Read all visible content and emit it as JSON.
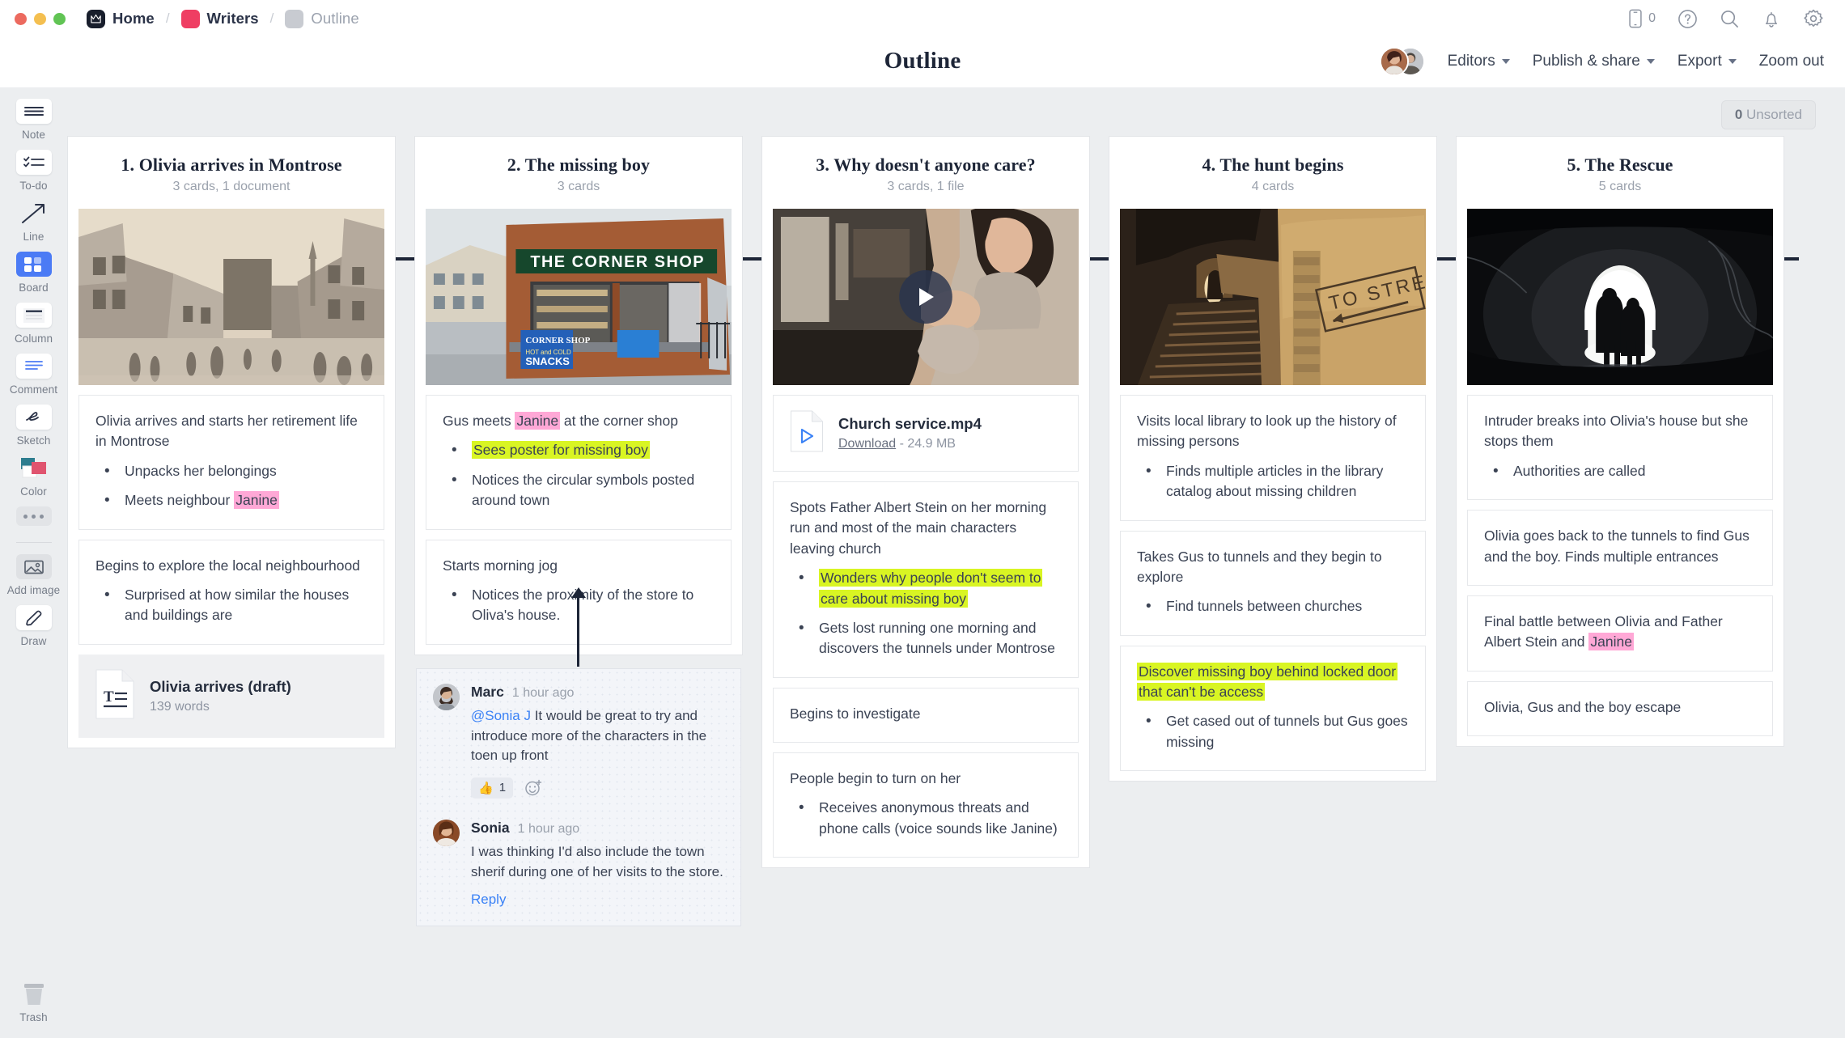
{
  "window": {
    "traffic_lights": [
      "close",
      "minimize",
      "maximize"
    ]
  },
  "breadcrumb": {
    "items": [
      {
        "label": "Home",
        "icon": "milanote-logo-icon",
        "color": "#181e2c"
      },
      {
        "label": "Writers",
        "icon": "board-swatch-icon",
        "color": "#ef3e63"
      },
      {
        "label": "Outline",
        "icon": "board-swatch-icon",
        "color": "#c8cbd1"
      }
    ],
    "separator": "/"
  },
  "topbar_icons": [
    {
      "name": "mobile-icon",
      "badge": "0"
    },
    {
      "name": "help-icon"
    },
    {
      "name": "search-icon"
    },
    {
      "name": "notifications-bell-icon"
    },
    {
      "name": "settings-gear-icon"
    }
  ],
  "header": {
    "title": "Outline",
    "actions": [
      {
        "label": "Editors",
        "has_caret": true
      },
      {
        "label": "Publish & share",
        "has_caret": true
      },
      {
        "label": "Export",
        "has_caret": true
      },
      {
        "label": "Zoom out",
        "has_caret": false
      }
    ]
  },
  "sidebar": {
    "tools": [
      {
        "label": "Note",
        "icon": "note-icon",
        "active": false
      },
      {
        "label": "To-do",
        "icon": "todo-icon",
        "active": false
      },
      {
        "label": "Line",
        "icon": "line-arrow-icon",
        "active": false
      },
      {
        "label": "Board",
        "icon": "board-icon",
        "active": true
      },
      {
        "label": "Column",
        "icon": "column-icon",
        "active": false
      },
      {
        "label": "Comment",
        "icon": "comment-icon",
        "active": false
      },
      {
        "label": "Sketch",
        "icon": "sketch-icon",
        "active": false
      },
      {
        "label": "Color",
        "icon": "color-swatches-icon",
        "active": false
      },
      {
        "label": "",
        "icon": "more-dots-icon",
        "active": false
      },
      {
        "label": "Add image",
        "icon": "add-image-icon",
        "active": false
      },
      {
        "label": "Draw",
        "icon": "draw-pencil-icon",
        "active": false
      }
    ],
    "trash": {
      "label": "Trash",
      "icon": "trash-icon"
    }
  },
  "canvas": {
    "unsorted_badge": {
      "count": "0",
      "label": "Unsorted"
    }
  },
  "columns": [
    {
      "title": "1. Olivia arrives in Montrose",
      "subtitle": "3 cards, 1 document",
      "hero": {
        "name": "vintage-street-photo",
        "type": "image"
      },
      "cards": [
        {
          "type": "note",
          "text": "Olivia arrives and starts her retirement life in Montrose",
          "bullets": [
            {
              "text": "Unpacks her belongings"
            },
            {
              "text": "Meets neighbour ",
              "highlight": "Janine",
              "highlight_color": "pink"
            }
          ]
        },
        {
          "type": "note",
          "text": "Begins to explore the local neighbourhood",
          "bullets": [
            {
              "text": "Surprised at how similar the houses and buildings are"
            }
          ]
        },
        {
          "type": "document",
          "name": "Olivia arrives (draft)",
          "meta": "139 words",
          "icon": "text-document-icon"
        }
      ]
    },
    {
      "title": "2. The missing boy",
      "subtitle": "3 cards",
      "hero": {
        "name": "corner-shop-photo",
        "type": "image",
        "sign": "THE CORNER SHOP",
        "board": "HOT and COLD SNACKS"
      },
      "cards": [
        {
          "type": "note",
          "text_pre": "Gus meets ",
          "text_hl": "Janine",
          "text_hl_color": "pink",
          "text_post": " at the corner shop",
          "bullets": [
            {
              "text": "Sees poster for missing boy",
              "whole_highlight": "green"
            },
            {
              "text": "Notices the circular symbols posted around town"
            }
          ]
        },
        {
          "type": "note",
          "text": "Starts morning jog",
          "bullets": [
            {
              "text": "Notices the proximity of the store to Oliva's house."
            }
          ]
        }
      ],
      "comments": [
        {
          "author": "Marc",
          "time": "1 hour ago",
          "mention": "@Sonia J",
          "text": " It would be great to try and introduce more of the characters in the toen up front",
          "reaction": {
            "emoji": "👍",
            "count": "1"
          },
          "add_reaction_icon": "add-reaction-icon"
        },
        {
          "author": "Sonia",
          "time": "1 hour ago",
          "text": "I was thinking I'd also include the town sherif during one of her visits to the store.",
          "reply_label": "Reply"
        }
      ]
    },
    {
      "title": "3. Why doesn't anyone care?",
      "subtitle": "3 cards, 1 file",
      "hero": {
        "name": "woman-praying-video",
        "type": "video",
        "play_icon": "play-icon"
      },
      "cards": [
        {
          "type": "file",
          "name": "Church service.mp4",
          "download_label": "Download",
          "meta": " - 24.9 MB",
          "icon": "video-file-icon"
        },
        {
          "type": "note",
          "text": "Spots Father Albert Stein on her morning run and most of the main characters leaving church",
          "bullets": [
            {
              "text": "Wonders why people don't seem to care about missing boy",
              "whole_highlight": "green"
            },
            {
              "text": "Gets lost running one morning and discovers the tunnels under Montrose"
            }
          ]
        },
        {
          "type": "note",
          "text": "Begins to investigate",
          "bullets": []
        },
        {
          "type": "note",
          "text": "People begin to turn on her",
          "bullets": [
            {
              "text": "Receives anonymous threats and phone calls (voice sounds like Janine)"
            }
          ]
        }
      ]
    },
    {
      "title": "4. The hunt begins",
      "subtitle": "4 cards",
      "hero": {
        "name": "tunnel-stairs-photo",
        "type": "image",
        "sign": "TO STREET"
      },
      "cards": [
        {
          "type": "note",
          "text": "Visits local library to look up the history of missing persons",
          "bullets": [
            {
              "text": "Finds multiple articles in the library catalog about missing children"
            }
          ]
        },
        {
          "type": "note",
          "text": "Takes Gus to tunnels and they begin to explore",
          "bullets": [
            {
              "text": "Find tunnels between churches"
            }
          ]
        },
        {
          "type": "note",
          "text": "Discover missing boy behind locked door that can't be access",
          "text_highlight": "green",
          "bullets": [
            {
              "text": "Get cased out of tunnels but Gus goes missing"
            }
          ]
        }
      ]
    },
    {
      "title": "5. The Rescue",
      "subtitle": "5 cards",
      "hero": {
        "name": "tunnel-silhouettes-photo",
        "type": "image"
      },
      "cards": [
        {
          "type": "note",
          "text": "Intruder breaks into Olivia's house but she stops them",
          "bullets": [
            {
              "text": "Authorities are called"
            }
          ]
        },
        {
          "type": "note",
          "text": "Olivia goes back to the tunnels to find Gus and the boy. Finds multiple entrances",
          "bullets": []
        },
        {
          "type": "note",
          "text_pre": "Final battle between Olivia and Father Albert Stein and ",
          "text_hl": "Janine",
          "text_hl_color": "pink",
          "text_post": "",
          "bullets": []
        },
        {
          "type": "note",
          "text": "Olivia, Gus and the boy escape",
          "bullets": []
        }
      ]
    }
  ],
  "colors": {
    "accent_blue": "#4b7bf5",
    "highlight_pink": "#ffa8d6",
    "highlight_green": "#d9f523",
    "dark_navy": "#1d2537",
    "canvas_grey": "#eceef0"
  }
}
